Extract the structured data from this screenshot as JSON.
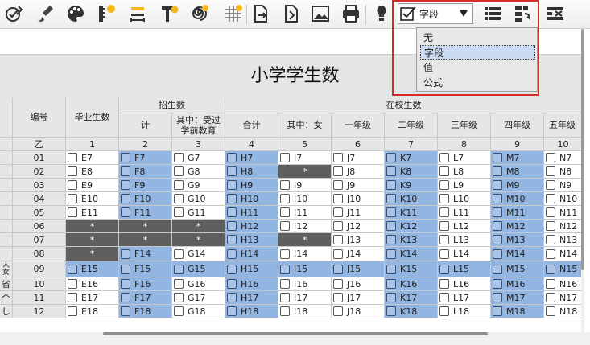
{
  "toolbar": {
    "icons": [
      "check-brush-icon",
      "palette-icon",
      "ruler-icon",
      "width-icon",
      "text-icon",
      "spiral-icon",
      "grid-icon",
      "export-icon",
      "image-icon",
      "printer-icon",
      "lightbulb-icon",
      "list-icon",
      "columns-icon",
      "delete-rows-icon"
    ],
    "combo_value": "字段"
  },
  "dropdown": {
    "options": [
      "无",
      "字段",
      "值",
      "公式"
    ],
    "selected": "字段"
  },
  "sheet": {
    "title": "小学学生数",
    "header": {
      "code": "编号",
      "graduates": "毕业生数",
      "enrollment": "招生数",
      "enroll_total": "计",
      "enroll_preschool_1": "其中：受过",
      "enroll_preschool_2": "学前教育",
      "in_school": "在校生数",
      "total": "合计",
      "female": "其中：女",
      "grade1": "一年级",
      "grade2": "二年级",
      "grade3": "三年级",
      "grade4": "四年级",
      "grade5": "五年级"
    },
    "index_row": [
      "乙",
      "1",
      "2",
      "3",
      "4",
      "5",
      "6",
      "7",
      "8",
      "9",
      "10"
    ],
    "left_fragments": [
      "人",
      "女",
      "省",
      "个",
      "し"
    ],
    "rows": [
      {
        "code": "01",
        "cells": [
          "E7",
          "F7",
          "G7",
          "H7",
          "I7",
          "J7",
          "K7",
          "L7",
          "M7",
          "N7"
        ]
      },
      {
        "code": "02",
        "cells": [
          "E8",
          "F8",
          "G8",
          "H8",
          "*",
          "J8",
          "K8",
          "L8",
          "M8",
          "N8"
        ]
      },
      {
        "code": "03",
        "cells": [
          "E9",
          "F9",
          "G9",
          "H9",
          "I9",
          "J9",
          "K9",
          "L9",
          "M9",
          "N9"
        ]
      },
      {
        "code": "04",
        "cells": [
          "E10",
          "F10",
          "G10",
          "H10",
          "I10",
          "J10",
          "K10",
          "L10",
          "M10",
          "N10"
        ]
      },
      {
        "code": "05",
        "cells": [
          "E11",
          "F11",
          "G11",
          "H11",
          "I11",
          "J11",
          "K11",
          "L11",
          "M11",
          "N11"
        ]
      },
      {
        "code": "06",
        "cells": [
          "*",
          "*",
          "*",
          "H12",
          "I12",
          "J12",
          "K12",
          "L12",
          "M12",
          "N12"
        ]
      },
      {
        "code": "07",
        "cells": [
          "*",
          "*",
          "*",
          "H13",
          "*",
          "J13",
          "K13",
          "L13",
          "M13",
          "N13"
        ]
      },
      {
        "code": "08",
        "cells": [
          "*",
          "F14",
          "G14",
          "H14",
          "I14",
          "J14",
          "K14",
          "L14",
          "M14",
          "N14"
        ]
      },
      {
        "code": "09",
        "cells": [
          "E15",
          "F15",
          "G15",
          "H15",
          "I15",
          "J15",
          "K15",
          "L15",
          "M15",
          "N15"
        ]
      },
      {
        "code": "10",
        "cells": [
          "E16",
          "F16",
          "G16",
          "H16",
          "I16",
          "J16",
          "K16",
          "L16",
          "M16",
          "N16"
        ]
      },
      {
        "code": "11",
        "cells": [
          "E17",
          "F17",
          "G17",
          "H17",
          "I17",
          "J17",
          "K17",
          "L17",
          "M17",
          "N17"
        ]
      },
      {
        "code": "12",
        "cells": [
          "E18",
          "F18",
          "G18",
          "H18",
          "I18",
          "J18",
          "K18",
          "L18",
          "M18",
          "N18"
        ]
      }
    ]
  },
  "colors": {
    "blue_cell": "#93b5e1",
    "dark_cell": "#5f5f5f",
    "header": "#e6e6e6",
    "highlight_border": "#d62b2b"
  }
}
